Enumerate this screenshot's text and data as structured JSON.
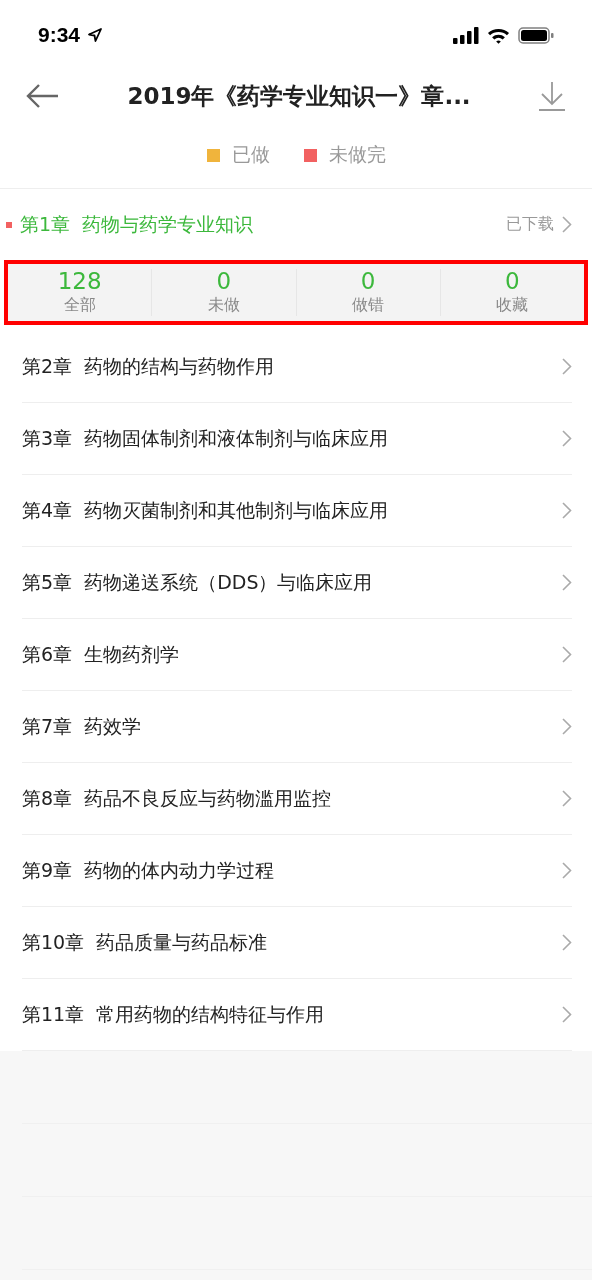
{
  "status_bar": {
    "time": "9:34"
  },
  "nav": {
    "title": "2019年《药学专业知识一》章..."
  },
  "legend": [
    {
      "label": "已做",
      "color": "#f0b43c"
    },
    {
      "label": "未做完",
      "color": "#f26161"
    }
  ],
  "chapters": [
    {
      "number": "第1章",
      "title": "药物与药学专业知识",
      "expanded": true,
      "color": "#f26161",
      "download": "已下载",
      "highlighted": true,
      "stats": [
        {
          "value": "128",
          "label": "全部"
        },
        {
          "value": "0",
          "label": "未做"
        },
        {
          "value": "0",
          "label": "做错"
        },
        {
          "value": "0",
          "label": "收藏"
        }
      ]
    },
    {
      "number": "第2章",
      "title": "药物的结构与药物作用",
      "expanded": false
    },
    {
      "number": "第3章",
      "title": "药物固体制剂和液体制剂与临床应用",
      "expanded": false
    },
    {
      "number": "第4章",
      "title": "药物灭菌制剂和其他制剂与临床应用",
      "expanded": false
    },
    {
      "number": "第5章",
      "title": "药物递送系统（DDS）与临床应用",
      "expanded": false
    },
    {
      "number": "第6章",
      "title": "生物药剂学",
      "expanded": false
    },
    {
      "number": "第7章",
      "title": "药效学",
      "expanded": false
    },
    {
      "number": "第8章",
      "title": "药品不良反应与药物滥用监控",
      "expanded": false
    },
    {
      "number": "第9章",
      "title": "药物的体内动力学过程",
      "expanded": false
    },
    {
      "number": "第10章",
      "title": "药品质量与药品标准",
      "expanded": false
    },
    {
      "number": "第11章",
      "title": "常用药物的结构特征与作用",
      "expanded": false
    }
  ]
}
